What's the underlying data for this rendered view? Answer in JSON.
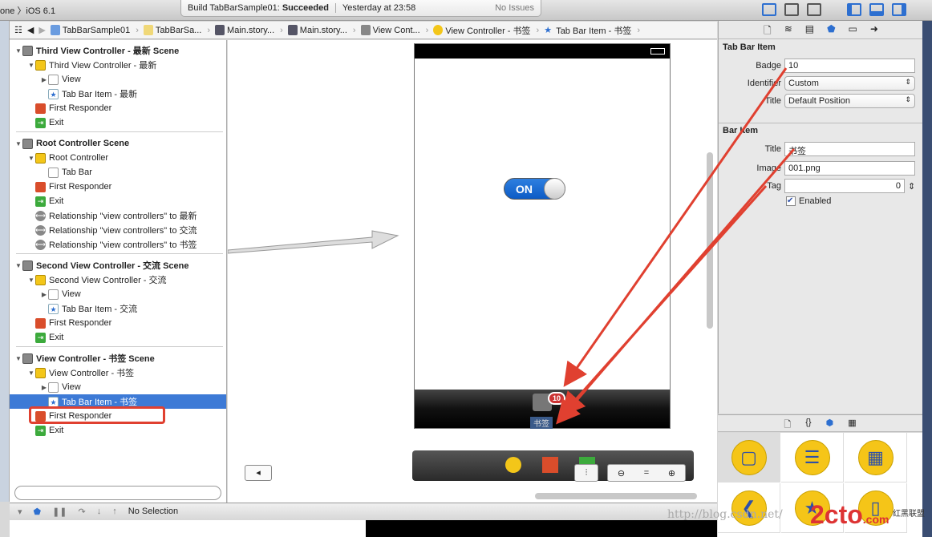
{
  "toolbar": {
    "scheme": "one 〉iOS 6.1",
    "build_label": "Build TabBarSample01:",
    "build_status": "Succeeded",
    "time": "Yesterday at 23:58",
    "issues": "No Issues"
  },
  "pathbar": [
    "TabBarSample01",
    "TabBarSa...",
    "Main.story...",
    "Main.story...",
    "View Cont...",
    "View Controller - 书签",
    "Tab Bar Item - 书签"
  ],
  "outline": [
    {
      "label": "Third View Controller - 最新 Scene",
      "level": 0,
      "icon": "scene",
      "bold": true,
      "arrow": true
    },
    {
      "label": "Third View Controller - 最新",
      "level": 1,
      "icon": "vc",
      "arrow": true
    },
    {
      "label": "View",
      "level": 2,
      "icon": "view",
      "arrow": true
    },
    {
      "label": "Tab Bar Item - 最新",
      "level": 2,
      "icon": "tab"
    },
    {
      "label": "First Responder",
      "level": 1,
      "icon": "fr"
    },
    {
      "label": "Exit",
      "level": 1,
      "icon": "exit"
    },
    {
      "label": "Root Controller Scene",
      "level": 0,
      "icon": "scene",
      "bold": true,
      "arrow": true
    },
    {
      "label": "Root Controller",
      "level": 1,
      "icon": "vc",
      "arrow": true
    },
    {
      "label": "Tab Bar",
      "level": 2,
      "icon": "view"
    },
    {
      "label": "First Responder",
      "level": 1,
      "icon": "fr"
    },
    {
      "label": "Exit",
      "level": 1,
      "icon": "exit"
    },
    {
      "label": "Relationship \"view controllers\" to 最新",
      "level": 1,
      "icon": "rel"
    },
    {
      "label": "Relationship \"view controllers\" to 交流",
      "level": 1,
      "icon": "rel"
    },
    {
      "label": "Relationship \"view controllers\" to 书签",
      "level": 1,
      "icon": "rel"
    },
    {
      "label": "Second View Controller - 交流 Scene",
      "level": 0,
      "icon": "scene",
      "bold": true,
      "arrow": true
    },
    {
      "label": "Second View Controller - 交流",
      "level": 1,
      "icon": "vc",
      "arrow": true
    },
    {
      "label": "View",
      "level": 2,
      "icon": "view",
      "arrow": true
    },
    {
      "label": "Tab Bar Item - 交流",
      "level": 2,
      "icon": "tab"
    },
    {
      "label": "First Responder",
      "level": 1,
      "icon": "fr"
    },
    {
      "label": "Exit",
      "level": 1,
      "icon": "exit"
    },
    {
      "label": "View Controller - 书签 Scene",
      "level": 0,
      "icon": "scene",
      "bold": true,
      "arrow": true
    },
    {
      "label": "View Controller - 书签",
      "level": 1,
      "icon": "vc",
      "arrow": true
    },
    {
      "label": "View",
      "level": 2,
      "icon": "view",
      "arrow": true
    },
    {
      "label": "Tab Bar Item - 书签",
      "level": 2,
      "icon": "tab",
      "selected": true
    },
    {
      "label": "First Responder",
      "level": 1,
      "icon": "fr"
    },
    {
      "label": "Exit",
      "level": 1,
      "icon": "exit"
    }
  ],
  "phone": {
    "switch_label": "ON",
    "badge": "10",
    "tab_title": "书签"
  },
  "inspector": {
    "tab_bar_item": {
      "header": "Tab Bar Item",
      "badge_label": "Badge",
      "badge": "10",
      "identifier_label": "Identifier",
      "identifier": "Custom",
      "title_label": "Title",
      "title": "Default Position"
    },
    "bar_item": {
      "header": "Bar Item",
      "title_label": "Title",
      "title": "书签",
      "image_label": "Image",
      "image": "001.png",
      "tag_label": "Tag",
      "tag": "0",
      "enabled_label": "Enabled",
      "enabled": true
    }
  },
  "debug": {
    "status": "No Selection"
  },
  "watermark": {
    "url": "http://blog.csdn.net/",
    "site": "2cto",
    "site2": ".com",
    "label": "红黑联盟"
  },
  "colors": {
    "accent": "#3d7ad6",
    "annotation": "#e04030"
  }
}
